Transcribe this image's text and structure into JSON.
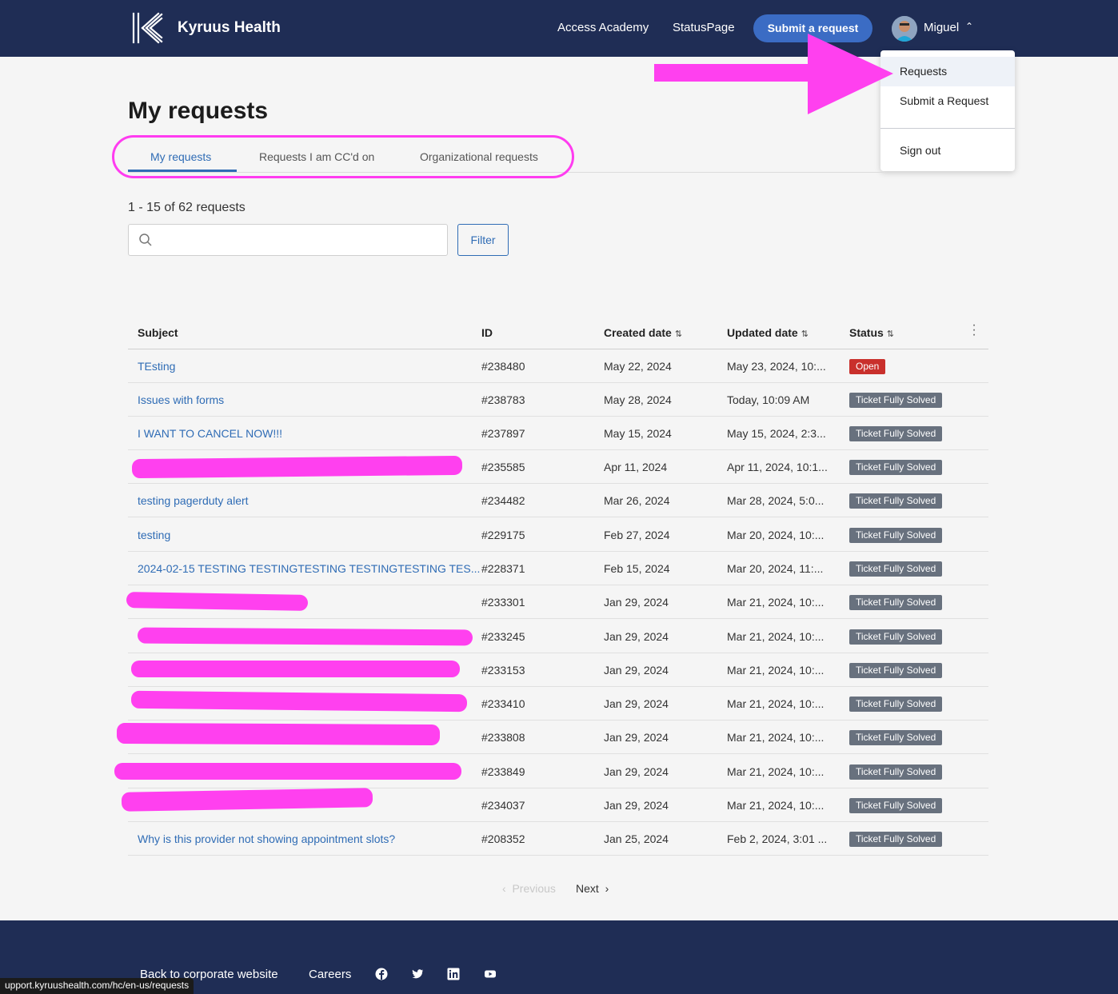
{
  "header": {
    "brand": "Kyruus Health",
    "links": [
      "Access Academy",
      "StatusPage"
    ],
    "submit_label": "Submit a request",
    "user_name": "Miguel"
  },
  "dropdown": {
    "items": [
      "Requests",
      "Submit a Request",
      "Sign out"
    ]
  },
  "page": {
    "title": "My requests",
    "tabs": [
      "My requests",
      "Requests I am CC'd on",
      "Organizational requests"
    ],
    "count": "1 - 15 of 62 requests",
    "search_placeholder": "",
    "filter_label": "Filter"
  },
  "table": {
    "headers": [
      "Subject",
      "ID",
      "Created date",
      "Updated date",
      "Status"
    ],
    "rows": [
      {
        "subject": "TEsting",
        "id": "#238480",
        "created": "May 22, 2024",
        "updated": "May 23, 2024, 10:...",
        "status": "Open"
      },
      {
        "subject": "Issues with forms",
        "id": "#238783",
        "created": "May 28, 2024",
        "updated": "Today, 10:09 AM",
        "status": "Ticket Fully Solved"
      },
      {
        "subject": "I WANT TO CANCEL NOW!!!",
        "id": "#237897",
        "created": "May 15, 2024",
        "updated": "May 15, 2024, 2:3...",
        "status": "Ticket Fully Solved"
      },
      {
        "subject": "",
        "id": "#235585",
        "created": "Apr 11, 2024",
        "updated": "Apr 11, 2024, 10:1...",
        "status": "Ticket Fully Solved"
      },
      {
        "subject": "testing pagerduty alert",
        "id": "#234482",
        "created": "Mar 26, 2024",
        "updated": "Mar 28, 2024, 5:0...",
        "status": "Ticket Fully Solved"
      },
      {
        "subject": "testing",
        "id": "#229175",
        "created": "Feb 27, 2024",
        "updated": "Mar 20, 2024, 10:...",
        "status": "Ticket Fully Solved"
      },
      {
        "subject": "2024-02-15 TESTING TESTINGTESTING TESTINGTESTING TES...",
        "id": "#228371",
        "created": "Feb 15, 2024",
        "updated": "Mar 20, 2024, 11:...",
        "status": "Ticket Fully Solved"
      },
      {
        "subject": "",
        "id": "#233301",
        "created": "Jan 29, 2024",
        "updated": "Mar 21, 2024, 10:...",
        "status": "Ticket Fully Solved"
      },
      {
        "subject": "",
        "id": "#233245",
        "created": "Jan 29, 2024",
        "updated": "Mar 21, 2024, 10:...",
        "status": "Ticket Fully Solved"
      },
      {
        "subject": "",
        "id": "#233153",
        "created": "Jan 29, 2024",
        "updated": "Mar 21, 2024, 10:...",
        "status": "Ticket Fully Solved"
      },
      {
        "subject": "",
        "id": "#233410",
        "created": "Jan 29, 2024",
        "updated": "Mar 21, 2024, 10:...",
        "status": "Ticket Fully Solved"
      },
      {
        "subject": "",
        "id": "#233808",
        "created": "Jan 29, 2024",
        "updated": "Mar 21, 2024, 10:...",
        "status": "Ticket Fully Solved"
      },
      {
        "subject": "",
        "id": "#233849",
        "created": "Jan 29, 2024",
        "updated": "Mar 21, 2024, 10:...",
        "status": "Ticket Fully Solved"
      },
      {
        "subject": "",
        "id": "#234037",
        "created": "Jan 29, 2024",
        "updated": "Mar 21, 2024, 10:...",
        "status": "Ticket Fully Solved"
      },
      {
        "subject": "Why is this provider not showing appointment slots?",
        "id": "#208352",
        "created": "Jan 25, 2024",
        "updated": "Feb 2, 2024, 3:01 ...",
        "status": "Ticket Fully Solved"
      }
    ]
  },
  "pagination": {
    "previous": "Previous",
    "next": "Next"
  },
  "footer": {
    "links": [
      "Back to corporate website",
      "Careers"
    ],
    "social": [
      "facebook-icon",
      "twitter-icon",
      "linkedin-icon",
      "youtube-icon"
    ],
    "status_url": "upport.kyruushealth.com/hc/en-us/requests"
  },
  "colors": {
    "header_bg": "#1f2d55",
    "accent": "#2f6cb5",
    "annotation": "#ff40ef",
    "open_badge": "#c9302c",
    "solved_badge": "#68717e"
  }
}
